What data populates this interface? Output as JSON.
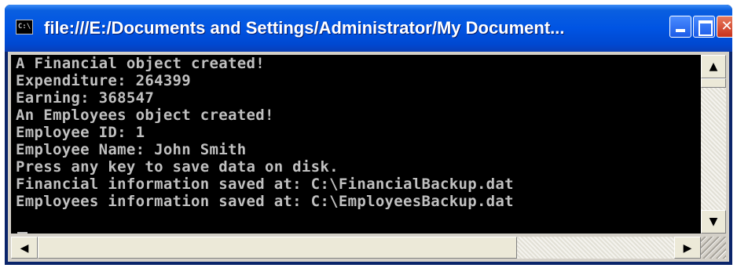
{
  "window": {
    "title": "file:///E:/Documents and Settings/Administrator/My Document...",
    "icon_name": "console-app-icon",
    "icon_glyph": "C:\\",
    "controls": {
      "minimize": "minimize-icon",
      "maximize": "maximize-icon",
      "close": "close-icon",
      "close_glyph": "✕"
    }
  },
  "console": {
    "lines": [
      "A Financial object created!",
      "Expenditure: 264399",
      "Earning: 368547",
      "An Employees object created!",
      "Employee ID: 1",
      "Employee Name: John Smith",
      "Press any key to save data on disk.",
      "Financial information saved at: C:\\FinancialBackup.dat",
      "Employees information saved at: C:\\EmployeesBackup.dat"
    ]
  },
  "scrollbars": {
    "up_glyph": "▲",
    "down_glyph": "▼",
    "left_glyph": "◀",
    "right_glyph": "▶"
  },
  "colors": {
    "titlebar": "#0054e3",
    "console_bg": "#000000",
    "console_text": "#c0c0c0",
    "close_button": "#c8321c"
  }
}
